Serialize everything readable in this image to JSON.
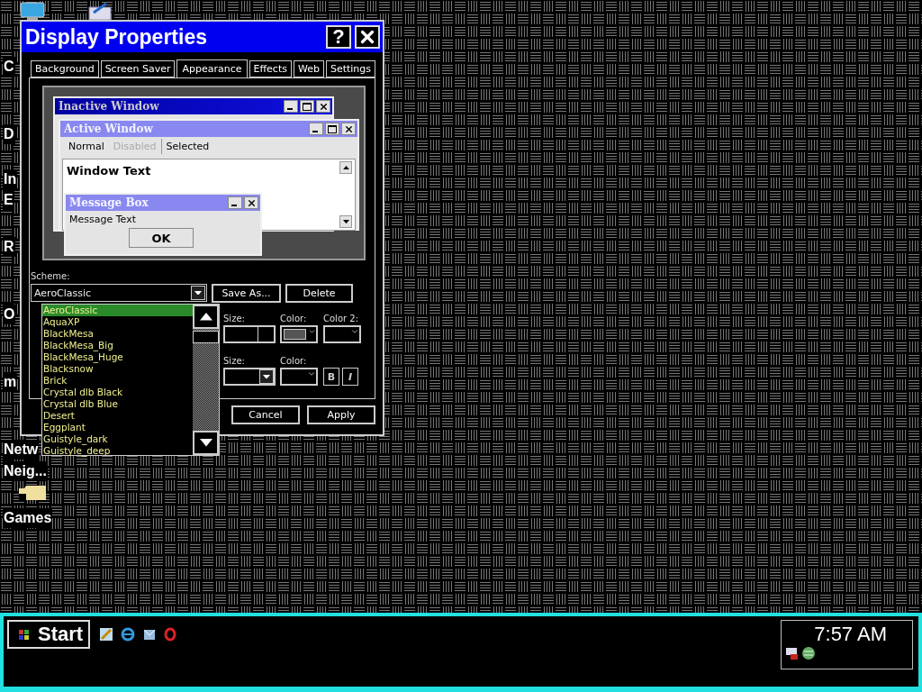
{
  "desktop": {
    "icon_labels": [
      "C",
      "D",
      "In",
      "E",
      "R",
      "O",
      "m",
      "Netw",
      "Neig...",
      "Games"
    ]
  },
  "window": {
    "title": "Display Properties",
    "help": "?"
  },
  "tabs": [
    {
      "label": "Background",
      "selected": false
    },
    {
      "label": "Screen Saver",
      "selected": false
    },
    {
      "label": "Appearance",
      "selected": true
    },
    {
      "label": "Effects",
      "selected": false
    },
    {
      "label": "Web",
      "selected": false
    },
    {
      "label": "Settings",
      "selected": false
    }
  ],
  "preview": {
    "inactive_title": "Inactive Window",
    "active_title": "Active Window",
    "menu": [
      {
        "label": "Normal",
        "disabled": false,
        "selected": false
      },
      {
        "label": "Disabled",
        "disabled": true,
        "selected": false
      },
      {
        "label": "Selected",
        "disabled": false,
        "selected": true
      }
    ],
    "window_text": "Window Text",
    "message_title": "Message Box",
    "message_text": "Message Text",
    "ok": "OK"
  },
  "scheme": {
    "label": "Scheme:",
    "value": "AeroClassic",
    "buttons": [
      "Save As...",
      "Delete"
    ],
    "options": [
      {
        "label": "AeroClassic",
        "selected": true
      },
      {
        "label": "AquaXP",
        "selected": false
      },
      {
        "label": "BlackMesa",
        "selected": false
      },
      {
        "label": "BlackMesa_Big",
        "selected": false
      },
      {
        "label": "BlackMesa_Huge",
        "selected": false
      },
      {
        "label": "Blacksnow",
        "selected": false
      },
      {
        "label": "Brick",
        "selected": false
      },
      {
        "label": "Crystal dlb Black",
        "selected": false
      },
      {
        "label": "Crystal dlb Blue",
        "selected": false
      },
      {
        "label": "Desert",
        "selected": false
      },
      {
        "label": "Eggplant",
        "selected": false
      },
      {
        "label": "Guistyle_dark",
        "selected": false
      },
      {
        "label": "Guistyle_deep",
        "selected": false
      }
    ]
  },
  "item_row": {
    "size_label": "Size:",
    "color_label": "Color:",
    "color2_label": "Color 2:",
    "color": "#555555"
  },
  "font_row": {
    "size_label": "Size:",
    "color_label": "Color:",
    "bold": "B",
    "italic": "I"
  },
  "footer_buttons": [
    "Cancel",
    "Apply"
  ],
  "taskbar": {
    "start": "Start",
    "clock": "7:57 AM"
  }
}
